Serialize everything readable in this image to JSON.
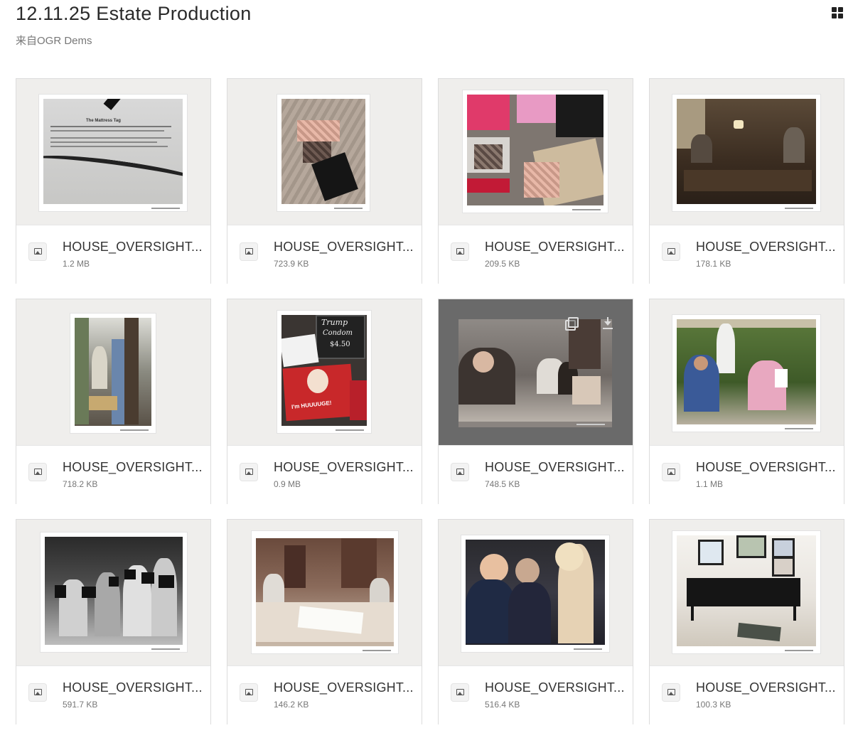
{
  "header": {
    "title": "12.11.25 Estate Production",
    "subtitle": "来自OGR Dems"
  },
  "files": [
    {
      "name": "HOUSE_OVERSIGHT...",
      "size": "1.2 MB"
    },
    {
      "name": "HOUSE_OVERSIGHT...",
      "size": "723.9 KB"
    },
    {
      "name": "HOUSE_OVERSIGHT...",
      "size": "209.5 KB"
    },
    {
      "name": "HOUSE_OVERSIGHT...",
      "size": "178.1 KB"
    },
    {
      "name": "HOUSE_OVERSIGHT...",
      "size": "718.2 KB"
    },
    {
      "name": "HOUSE_OVERSIGHT...",
      "size": "0.9 MB"
    },
    {
      "name": "HOUSE_OVERSIGHT...",
      "size": "748.5 KB"
    },
    {
      "name": "HOUSE_OVERSIGHT...",
      "size": "1.1 MB"
    },
    {
      "name": "HOUSE_OVERSIGHT...",
      "size": "591.7 KB"
    },
    {
      "name": "HOUSE_OVERSIGHT...",
      "size": "146.2 KB"
    },
    {
      "name": "HOUSE_OVERSIGHT...",
      "size": "516.4 KB"
    },
    {
      "name": "HOUSE_OVERSIGHT...",
      "size": "100.3 KB"
    }
  ],
  "thumb_text": {
    "doc_heading": "The Mattress Tag",
    "sign_line1": "Trump",
    "sign_line2": "Condom",
    "sign_line3": "$4.50",
    "pack_text": "I'm HUUUUGE!"
  },
  "icons": {
    "view_toggle": "grid-view-icon",
    "file_type": "image-file-icon",
    "copy": "copy-icon",
    "download": "download-icon"
  },
  "colors": {
    "preview_bg": "#efeeec",
    "hover_preview_bg": "#6a6a6a",
    "border": "#dcdcdc"
  }
}
